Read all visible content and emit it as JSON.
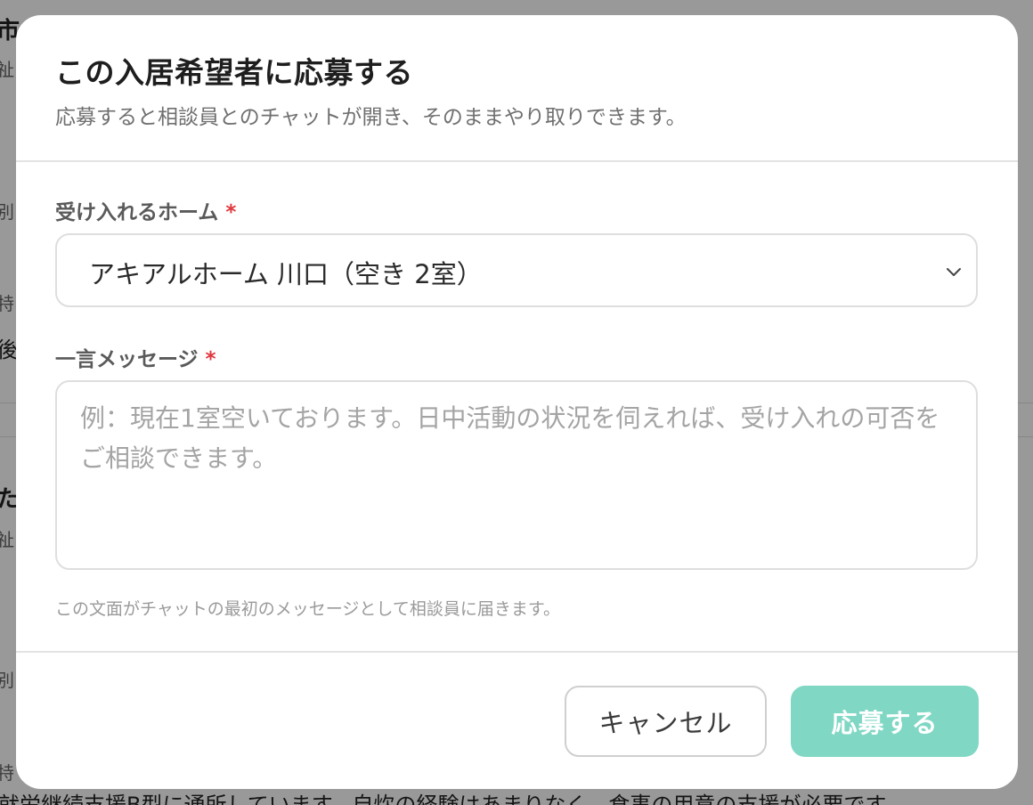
{
  "background": {
    "fragments": [
      "市",
      "祉",
      "別",
      "特",
      "後",
      "た",
      "祉",
      "別",
      "特"
    ],
    "bottom_text": "就労継続支援B型に通所しています。自炊の経験はあまりなく、食事の用意の支援が必要です。"
  },
  "modal": {
    "title": "この入居希望者に応募する",
    "subtitle": "応募すると相談員とのチャットが開き、そのままやり取りできます。",
    "home_field": {
      "label": "受け入れるホーム",
      "required_mark": "*",
      "selected_value": "アキアルホーム 川口（空き 2室）"
    },
    "message_field": {
      "label": "一言メッセージ",
      "required_mark": "*",
      "placeholder": "例：現在1室空いております。日中活動の状況を伺えれば、受け入れの可否をご相談できます。",
      "value": ""
    },
    "hint": "この文面がチャットの最初のメッセージとして相談員に届きます。",
    "buttons": {
      "cancel": "キャンセル",
      "apply": "応募する"
    }
  },
  "colors": {
    "accent": "#7fd7c4",
    "required": "#e0383e",
    "overlay": "rgba(0,0,0,0.40)"
  }
}
